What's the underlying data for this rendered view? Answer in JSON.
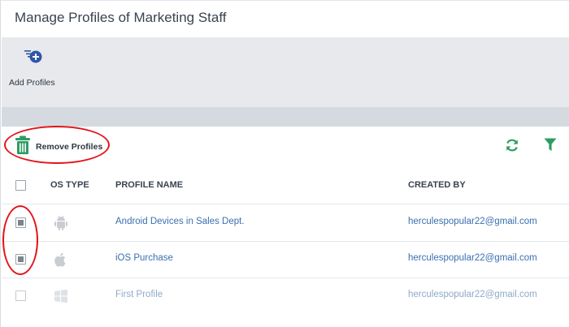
{
  "page": {
    "title": "Manage Profiles of Marketing Staff"
  },
  "toolbar": {
    "add_profiles_label": "Add Profiles",
    "add_icon": "add-profile-icon"
  },
  "actions": {
    "remove_profiles_label": "Remove Profiles",
    "remove_icon": "trash-icon",
    "refresh_icon": "refresh-icon",
    "filter_icon": "filter-icon"
  },
  "table": {
    "columns": [
      "OS TYPE",
      "PROFILE NAME",
      "CREATED BY"
    ],
    "rows": [
      {
        "os": "android",
        "name": "Android Devices in Sales Dept.",
        "created_by": "herculespopular22@gmail.com",
        "selected": true
      },
      {
        "os": "ios",
        "name": "iOS Purchase",
        "created_by": "herculespopular22@gmail.com",
        "selected": true
      },
      {
        "os": "windows",
        "name": "First Profile",
        "created_by": "herculespopular22@gmail.com",
        "selected": false
      }
    ]
  },
  "colors": {
    "accent_green": "#2e9b63",
    "link_blue": "#3a6fb0",
    "highlight_red": "#e3151a",
    "icon_blue": "#2f56a6"
  }
}
